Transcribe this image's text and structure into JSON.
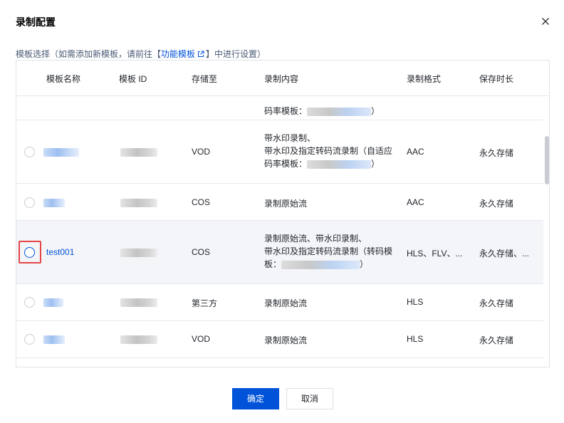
{
  "dialog": {
    "title": "录制配置",
    "close_icon": "close-icon"
  },
  "hint": {
    "prefix": "模板选择（如需添加新模板，请前往【",
    "link": "功能模板",
    "suffix": "】中进行设置）"
  },
  "table": {
    "headers": {
      "name": "模板名称",
      "id": "模板 ID",
      "storage": "存储至",
      "content": "录制内容",
      "format": "录制格式",
      "duration": "保存时长"
    },
    "rows": [
      {
        "name": "",
        "storage": "",
        "content_line1": "码率模板：",
        "content_line1_suffix": "）",
        "format": "",
        "duration": ""
      },
      {
        "name": "",
        "storage": "VOD",
        "content_line1": "带水印录制、",
        "content_line2": "带水印及指定转码流录制（自适应",
        "content_line3": "码率模板：",
        "content_line3_suffix": "）",
        "format": "AAC",
        "duration": "永久存储"
      },
      {
        "name": "",
        "storage": "COS",
        "content_line1": "录制原始流",
        "format": "AAC",
        "duration": "永久存储"
      },
      {
        "name": "test001",
        "storage": "COS",
        "content_line1": "录制原始流、带水印录制、",
        "content_line2": "带水印及指定转码流录制（转码模",
        "content_line3": "板：",
        "content_line3_suffix": "）",
        "format": "HLS、FLV、...",
        "duration": "永久存储、..."
      },
      {
        "name": "",
        "storage": "第三方",
        "content_line1": "录制原始流",
        "format": "HLS",
        "duration": "永久存储"
      },
      {
        "name": "",
        "storage": "VOD",
        "content_line1": "录制原始流",
        "format": "HLS",
        "duration": "永久存储"
      }
    ]
  },
  "footer": {
    "ok": "确定",
    "cancel": "取消"
  },
  "colors": {
    "primary": "#0052d9",
    "highlight_border": "#e54545",
    "row_hover": "#f3f5f8"
  }
}
